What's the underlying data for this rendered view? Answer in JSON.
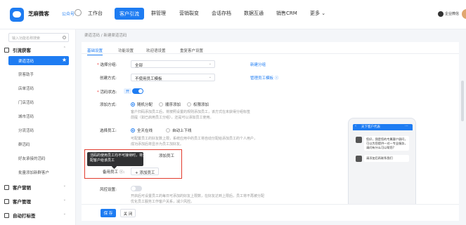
{
  "app": {
    "title": "芝麻微客",
    "tag": "公众号"
  },
  "nav": [
    "工作台",
    "客户引流",
    "群管理",
    "营销裂变",
    "会话存档",
    "数据互通",
    "销售CRM",
    "更多 ⌄"
  ],
  "nav_active_index": 1,
  "user": {
    "org": "企业微信"
  },
  "sidebar": {
    "search_placeholder": "输入功能名称搜索",
    "group1": "引流获客",
    "items": [
      "渠道活码",
      "获客助手",
      "店单活码",
      "门店活码",
      "城市活码",
      "分流活码",
      "群活码",
      "好友承接的活码",
      "批量添加新群客户"
    ],
    "active_index": 0,
    "group2": "客户营销",
    "group3": "客户管理",
    "group4": "自动打标签"
  },
  "breadcrumb": {
    "parent": "渠道活码",
    "sep": "/",
    "current": "新建渠道活码"
  },
  "tabs": [
    "基础设置",
    "功能设置",
    "欢迎语设置",
    "重复客户设置"
  ],
  "tabs_active_index": 0,
  "form": {
    "group_label": "选择分组:",
    "group_value": "全部",
    "group_link": "新建分组",
    "create_label": "创建方式:",
    "create_value": "不使用员工模板",
    "create_link": "管理员工模板 ⓘ",
    "toggle_label": "活码状态:",
    "toggle_tag": "开",
    "add_label": "添加方式:",
    "add_options": [
      "随机分配",
      "顺序添加",
      "权限添加"
    ],
    "add_hint1": "客户扫码添加员工后，将按照设置的规则添加员工，该方式在未获得分组标签",
    "add_hint2": "前提（如已启用员工分组），还是可以添加员工使用。",
    "pick_label": "选择员工:",
    "pick_options": [
      "全天在线",
      "自动上下线"
    ],
    "pick_hint1": "可配置员工的好友数上限，系统应用中的员工将自动分配给添加员工的个人用户，",
    "pick_hint2": "成功添加后将显示为员工加好友。",
    "team_label": "添加员工",
    "backup_label": "备用员工 ⓘ:",
    "backup_button": "+ 添加员工",
    "tooltip_line1": "活码的使用员工均不可接待时，将分",
    "tooltip_line2": "配客户给该员工",
    "limit_label": "风控设置:",
    "limit_hint1": "开启后可设置员工的每日可添加的好友上限数，在好友达到上限后，员工将不再被分配",
    "limit_hint2": "优化员工服务工作客户关系，减少风控。"
  },
  "footer": {
    "save": "保 存",
    "cancel": "关 闭"
  },
  "phone": {
    "title": "天下客户代表",
    "msg1_line1": "您好，我是您的专属客户顾问，",
    "msg1_line2": "可以为您提供一对一专业服务，",
    "msg1_line3": "请问有什么可以帮您?",
    "msg2": "请添加后再联系我们"
  }
}
